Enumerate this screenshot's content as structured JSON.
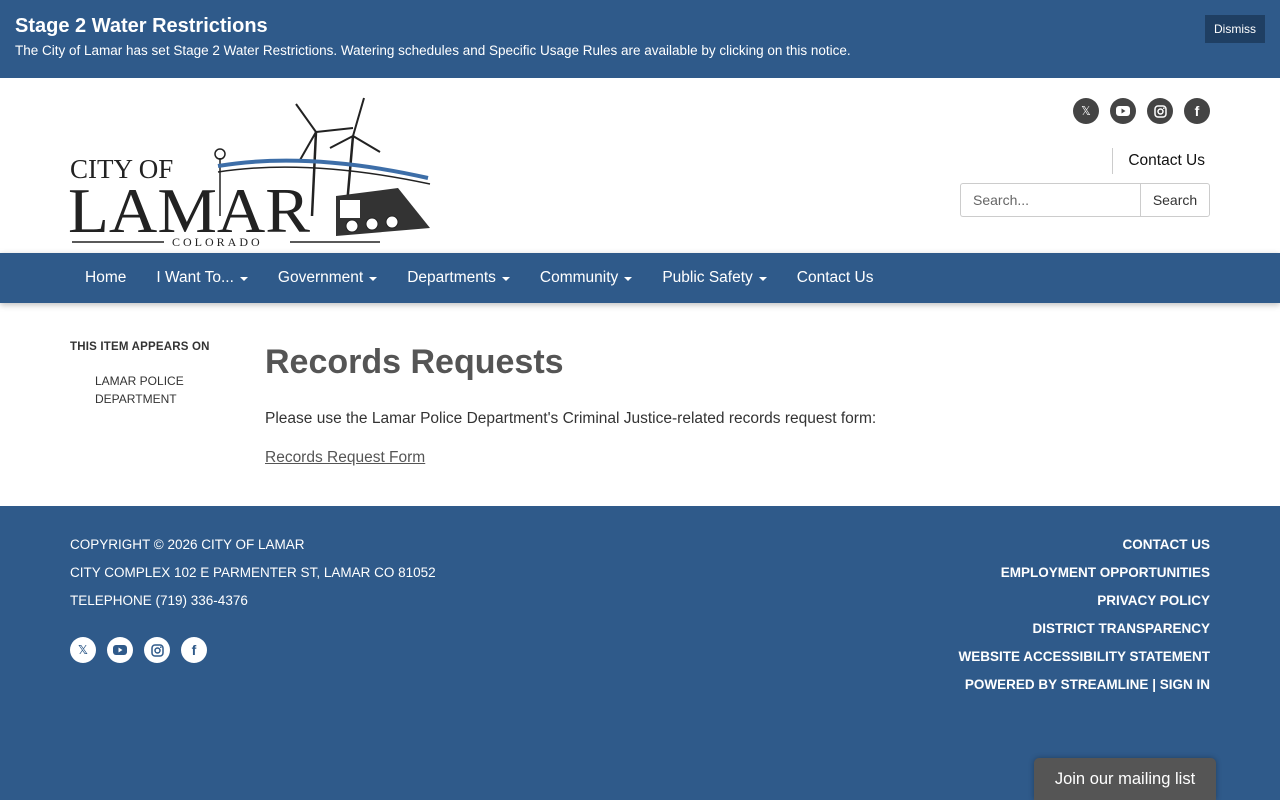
{
  "alert": {
    "title": "Stage 2 Water Restrictions",
    "text": "The City of Lamar has set Stage 2 Water Restrictions. Watering schedules and Specific Usage Rules are available by clicking on this notice.",
    "dismiss_label": "Dismiss"
  },
  "header": {
    "logo": {
      "line1": "CITY OF",
      "line2": "LAMAR",
      "line3": "COLORADO"
    },
    "social_icons": [
      "x-icon",
      "youtube-icon",
      "instagram-icon",
      "facebook-icon"
    ],
    "contact_label": "Contact Us",
    "search": {
      "placeholder": "Search...",
      "button_label": "Search"
    }
  },
  "nav": {
    "items": [
      {
        "label": "Home",
        "dropdown": false
      },
      {
        "label": "I Want To...",
        "dropdown": true
      },
      {
        "label": "Government",
        "dropdown": true
      },
      {
        "label": "Departments",
        "dropdown": true
      },
      {
        "label": "Community",
        "dropdown": true
      },
      {
        "label": "Public Safety",
        "dropdown": true
      },
      {
        "label": "Contact Us",
        "dropdown": false
      }
    ]
  },
  "sidebar": {
    "title": "THIS ITEM APPEARS ON",
    "link": "LAMAR POLICE DEPARTMENT"
  },
  "main": {
    "title": "Records Requests",
    "text": "Please use the Lamar Police Department's Criminal Justice-related records request form:",
    "link": "Records Request Form"
  },
  "footer": {
    "copyright": "COPYRIGHT © 2026 CITY OF LAMAR",
    "address": "CITY COMPLEX 102 E PARMENTER ST, LAMAR CO 81052",
    "telephone": "TELEPHONE (719) 336-4376",
    "links": [
      "CONTACT US",
      "EMPLOYMENT OPPORTUNITIES",
      "PRIVACY POLICY",
      "DISTRICT TRANSPARENCY",
      "WEBSITE ACCESSIBILITY STATEMENT"
    ],
    "powered_by": "POWERED BY STREAMLINE",
    "separator": "|",
    "sign_in": "SIGN IN",
    "mailing_label": "Join our mailing list"
  },
  "colors": {
    "brand_blue": "#2f5a8a",
    "dark_button": "#1f3f63",
    "mailing_gray": "#555555"
  }
}
